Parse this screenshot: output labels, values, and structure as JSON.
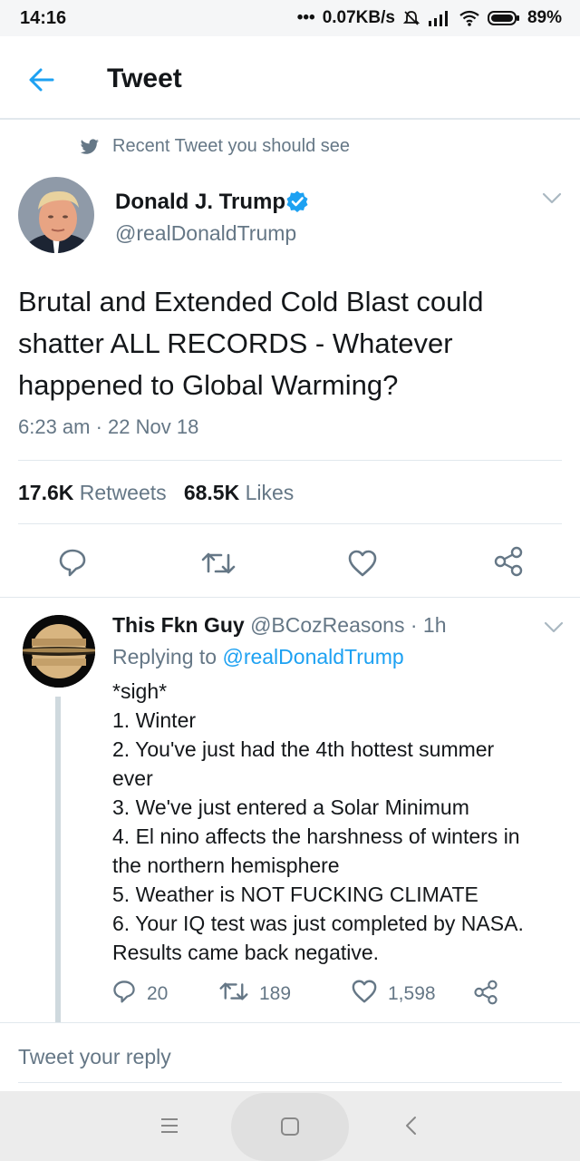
{
  "status_bar": {
    "time": "14:16",
    "network_speed": "0.07KB/s",
    "battery": "89%",
    "icons": [
      "dots-icon",
      "mute-icon",
      "signal-icon",
      "wifi-icon",
      "battery-icon"
    ]
  },
  "header": {
    "title": "Tweet",
    "back_icon": "back-arrow-icon"
  },
  "recent_label": "Recent Tweet you should see",
  "tweet": {
    "author_name": "Donald J. Trump",
    "author_handle": "@realDonaldTrump",
    "verified": true,
    "text": "Brutal and Extended Cold Blast could shatter ALL RECORDS - Whatever happened to Global Warming?",
    "timestamp": "6:23 am · 22 Nov 18",
    "retweets_count": "17.6K",
    "retweets_label": "Retweets",
    "likes_count": "68.5K",
    "likes_label": "Likes"
  },
  "reply": {
    "author_name": "This Fkn Guy",
    "author_handle": "@BCozReasons",
    "separator": "·",
    "time": "1h",
    "replying_prefix": "Replying to",
    "replying_to": "@realDonaldTrump",
    "lines": [
      "*sigh*",
      "1. Winter",
      "2. You've just had the 4th hottest summer",
      "ever",
      "3. We've just entered a Solar Minimum",
      "4. El nino affects the harshness of winters in",
      "the northern hemisphere",
      "5. Weather is NOT FUCKING CLIMATE",
      "6. Your IQ test was just completed by NASA.",
      "Results came back negative."
    ],
    "reply_count": "20",
    "retweet_count": "189",
    "like_count": "1,598"
  },
  "composer": {
    "placeholder": "Tweet your reply"
  },
  "colors": {
    "link": "#1da1f2",
    "secondary_text": "#657786",
    "icon_gray": "#657786"
  }
}
